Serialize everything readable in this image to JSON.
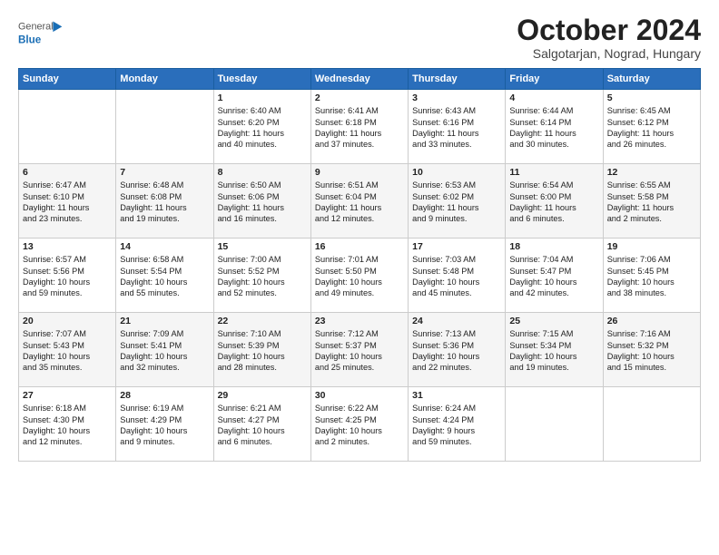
{
  "header": {
    "logo_line1": "General",
    "logo_line2": "Blue",
    "month": "October 2024",
    "location": "Salgotarjan, Nograd, Hungary"
  },
  "days_of_week": [
    "Sunday",
    "Monday",
    "Tuesday",
    "Wednesday",
    "Thursday",
    "Friday",
    "Saturday"
  ],
  "weeks": [
    [
      {
        "day": "",
        "info": ""
      },
      {
        "day": "",
        "info": ""
      },
      {
        "day": "1",
        "info": "Sunrise: 6:40 AM\nSunset: 6:20 PM\nDaylight: 11 hours\nand 40 minutes."
      },
      {
        "day": "2",
        "info": "Sunrise: 6:41 AM\nSunset: 6:18 PM\nDaylight: 11 hours\nand 37 minutes."
      },
      {
        "day": "3",
        "info": "Sunrise: 6:43 AM\nSunset: 6:16 PM\nDaylight: 11 hours\nand 33 minutes."
      },
      {
        "day": "4",
        "info": "Sunrise: 6:44 AM\nSunset: 6:14 PM\nDaylight: 11 hours\nand 30 minutes."
      },
      {
        "day": "5",
        "info": "Sunrise: 6:45 AM\nSunset: 6:12 PM\nDaylight: 11 hours\nand 26 minutes."
      }
    ],
    [
      {
        "day": "6",
        "info": "Sunrise: 6:47 AM\nSunset: 6:10 PM\nDaylight: 11 hours\nand 23 minutes."
      },
      {
        "day": "7",
        "info": "Sunrise: 6:48 AM\nSunset: 6:08 PM\nDaylight: 11 hours\nand 19 minutes."
      },
      {
        "day": "8",
        "info": "Sunrise: 6:50 AM\nSunset: 6:06 PM\nDaylight: 11 hours\nand 16 minutes."
      },
      {
        "day": "9",
        "info": "Sunrise: 6:51 AM\nSunset: 6:04 PM\nDaylight: 11 hours\nand 12 minutes."
      },
      {
        "day": "10",
        "info": "Sunrise: 6:53 AM\nSunset: 6:02 PM\nDaylight: 11 hours\nand 9 minutes."
      },
      {
        "day": "11",
        "info": "Sunrise: 6:54 AM\nSunset: 6:00 PM\nDaylight: 11 hours\nand 6 minutes."
      },
      {
        "day": "12",
        "info": "Sunrise: 6:55 AM\nSunset: 5:58 PM\nDaylight: 11 hours\nand 2 minutes."
      }
    ],
    [
      {
        "day": "13",
        "info": "Sunrise: 6:57 AM\nSunset: 5:56 PM\nDaylight: 10 hours\nand 59 minutes."
      },
      {
        "day": "14",
        "info": "Sunrise: 6:58 AM\nSunset: 5:54 PM\nDaylight: 10 hours\nand 55 minutes."
      },
      {
        "day": "15",
        "info": "Sunrise: 7:00 AM\nSunset: 5:52 PM\nDaylight: 10 hours\nand 52 minutes."
      },
      {
        "day": "16",
        "info": "Sunrise: 7:01 AM\nSunset: 5:50 PM\nDaylight: 10 hours\nand 49 minutes."
      },
      {
        "day": "17",
        "info": "Sunrise: 7:03 AM\nSunset: 5:48 PM\nDaylight: 10 hours\nand 45 minutes."
      },
      {
        "day": "18",
        "info": "Sunrise: 7:04 AM\nSunset: 5:47 PM\nDaylight: 10 hours\nand 42 minutes."
      },
      {
        "day": "19",
        "info": "Sunrise: 7:06 AM\nSunset: 5:45 PM\nDaylight: 10 hours\nand 38 minutes."
      }
    ],
    [
      {
        "day": "20",
        "info": "Sunrise: 7:07 AM\nSunset: 5:43 PM\nDaylight: 10 hours\nand 35 minutes."
      },
      {
        "day": "21",
        "info": "Sunrise: 7:09 AM\nSunset: 5:41 PM\nDaylight: 10 hours\nand 32 minutes."
      },
      {
        "day": "22",
        "info": "Sunrise: 7:10 AM\nSunset: 5:39 PM\nDaylight: 10 hours\nand 28 minutes."
      },
      {
        "day": "23",
        "info": "Sunrise: 7:12 AM\nSunset: 5:37 PM\nDaylight: 10 hours\nand 25 minutes."
      },
      {
        "day": "24",
        "info": "Sunrise: 7:13 AM\nSunset: 5:36 PM\nDaylight: 10 hours\nand 22 minutes."
      },
      {
        "day": "25",
        "info": "Sunrise: 7:15 AM\nSunset: 5:34 PM\nDaylight: 10 hours\nand 19 minutes."
      },
      {
        "day": "26",
        "info": "Sunrise: 7:16 AM\nSunset: 5:32 PM\nDaylight: 10 hours\nand 15 minutes."
      }
    ],
    [
      {
        "day": "27",
        "info": "Sunrise: 6:18 AM\nSunset: 4:30 PM\nDaylight: 10 hours\nand 12 minutes."
      },
      {
        "day": "28",
        "info": "Sunrise: 6:19 AM\nSunset: 4:29 PM\nDaylight: 10 hours\nand 9 minutes."
      },
      {
        "day": "29",
        "info": "Sunrise: 6:21 AM\nSunset: 4:27 PM\nDaylight: 10 hours\nand 6 minutes."
      },
      {
        "day": "30",
        "info": "Sunrise: 6:22 AM\nSunset: 4:25 PM\nDaylight: 10 hours\nand 2 minutes."
      },
      {
        "day": "31",
        "info": "Sunrise: 6:24 AM\nSunset: 4:24 PM\nDaylight: 9 hours\nand 59 minutes."
      },
      {
        "day": "",
        "info": ""
      },
      {
        "day": "",
        "info": ""
      }
    ]
  ]
}
